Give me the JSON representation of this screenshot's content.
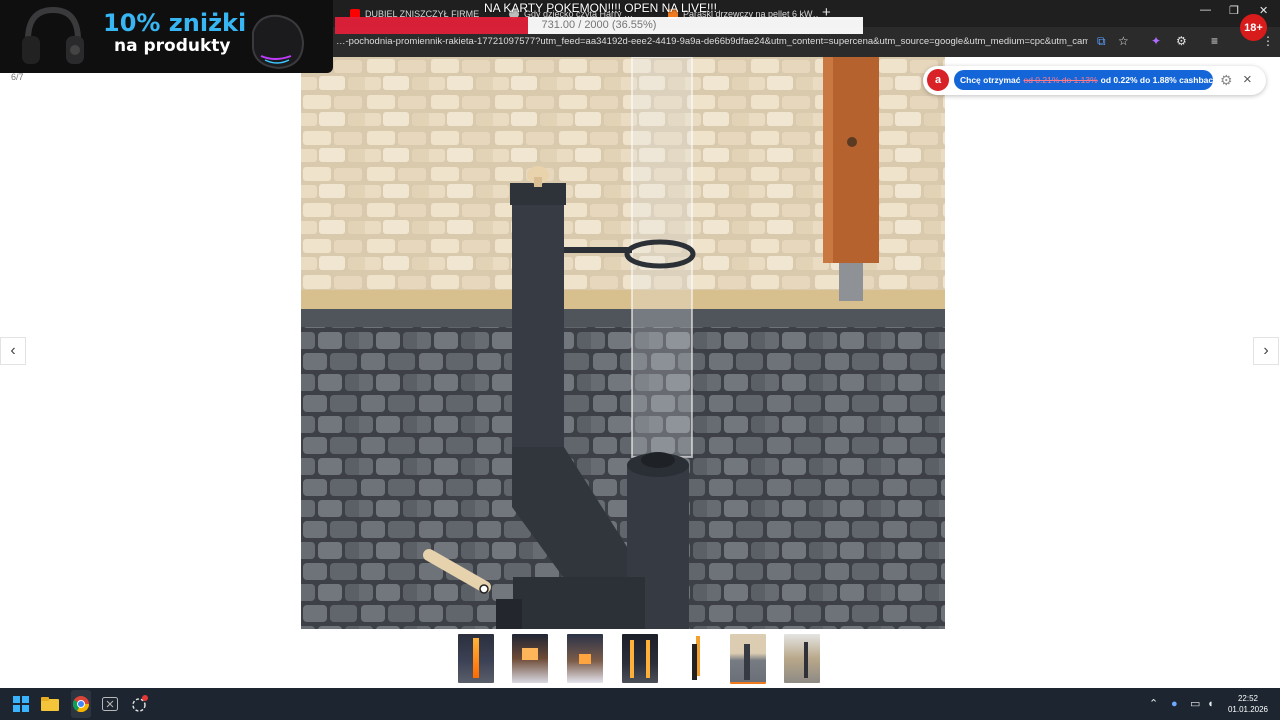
{
  "stream_overlay": {
    "live_text": "NA KARTY POKEMON!!!! OPEN NA LIVE!!!",
    "progress_text": "731.00 / 2000 (36.55%)",
    "progress_fraction": 0.3655,
    "promo_line1": "10% zniżki",
    "promo_line2": "na produkty",
    "age_badge": "18+"
  },
  "browser": {
    "tabs": [
      {
        "title": "DUBIEL ZNISZCZYŁ FIRMĘ KTÓ…",
        "favicon": "youtube-icon",
        "color": "#ff0000"
      },
      {
        "title": "Gdy dziecko czyta Harry …",
        "favicon": "globe-icon",
        "color": "#bdbdbd"
      },
      {
        "title": "Paraski drzewczy na pellet 6 kW…",
        "favicon": "shop-icon",
        "color": "#f07b1e"
      }
    ],
    "url": "…-pochodnia-promiennik-rakieta-17721097577?utm_feed=aa34192d-eee2-4419-9a9a-de66b9dfae24&utm_content=supercena&utm_source=google&utm_medium=cpc&utm_campa…"
  },
  "gallery": {
    "counter": "6/7",
    "prev_label": "‹",
    "next_label": "›",
    "thumb_count": 7,
    "active_thumb": 6
  },
  "cashback": {
    "lead": "Chcę otrzymać",
    "old_range": "od 0.21% do 1.13%",
    "new_range": "od 0.22% do 1.88% cashbacku",
    "close": "×",
    "logo": "a"
  },
  "taskbar": {
    "time": "22:52",
    "date": "01.01.2026"
  },
  "colors": {
    "accent_red": "#e2203a",
    "cashback_blue": "#1466d8",
    "active_thumb_underline": "#f07b1e"
  }
}
